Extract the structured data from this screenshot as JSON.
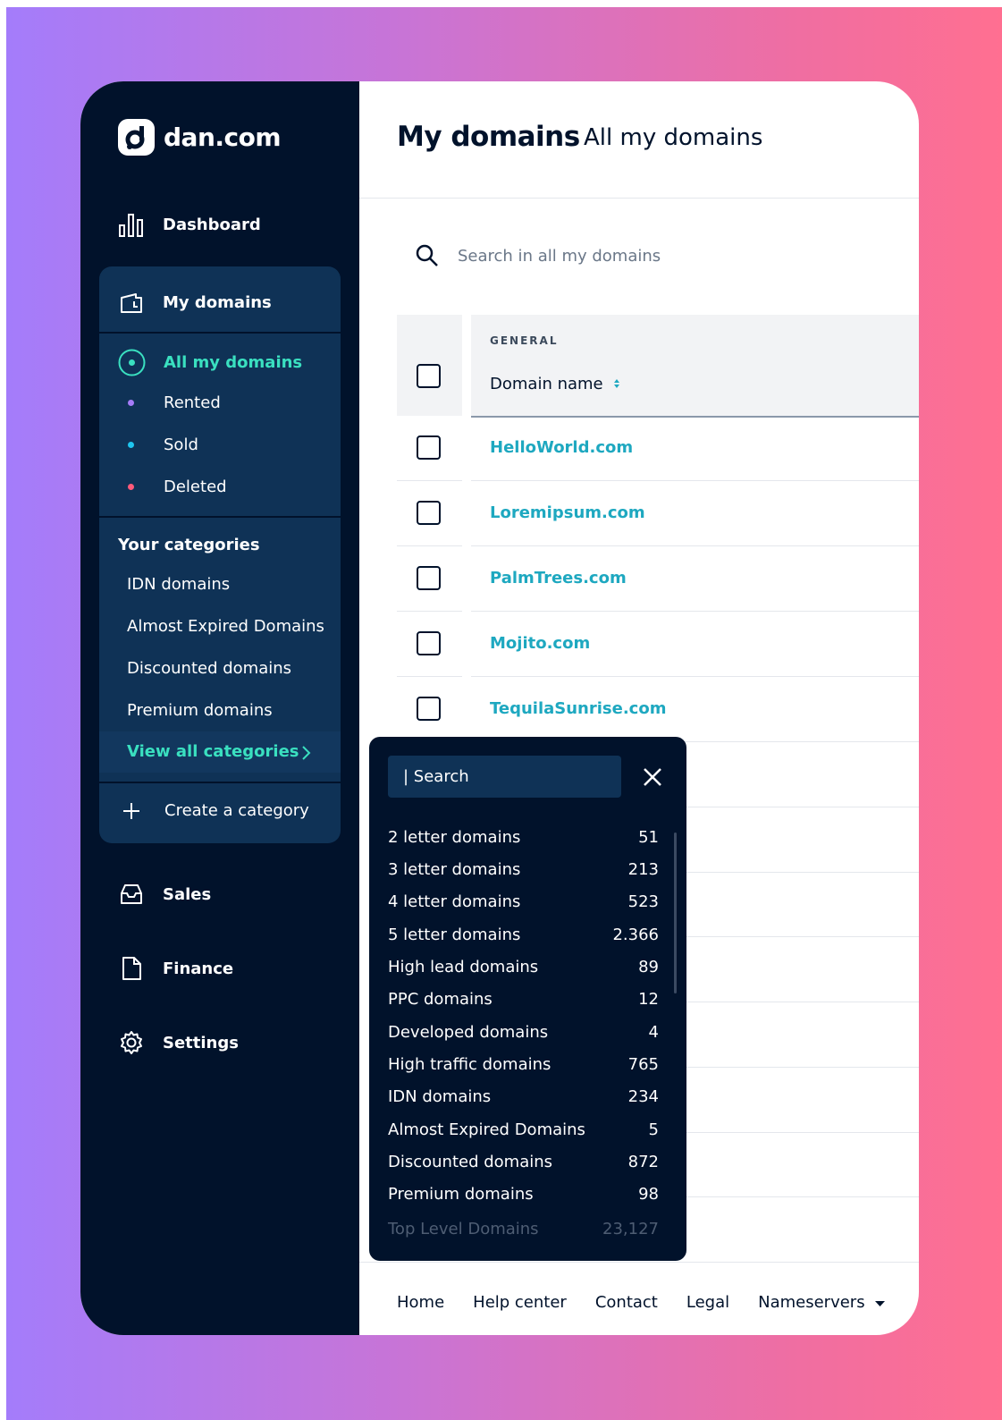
{
  "app": {
    "name": "dan.com"
  },
  "sidebar": {
    "dashboard": "Dashboard",
    "my_domains": "My domains",
    "filters": [
      {
        "label": "All my domains",
        "color": "#3ae0c0"
      },
      {
        "label": "Rented",
        "color": "#a57cf8"
      },
      {
        "label": "Sold",
        "color": "#1ec6f0"
      },
      {
        "label": "Deleted",
        "color": "#ff5a7a"
      }
    ],
    "categories_title": "Your categories",
    "categories": [
      "IDN domains",
      "Almost Expired Domains",
      "Discounted domains",
      "Premium domains"
    ],
    "view_all": "View all categories",
    "create": "Create a category",
    "sales": "Sales",
    "finance": "Finance",
    "settings": "Settings"
  },
  "main": {
    "title": "My domains",
    "subtitle": "All my domains",
    "search_placeholder": "Search in all my domains",
    "table": {
      "group_label": "GENERAL",
      "column": "Domain name",
      "rows": [
        "HelloWorld.com",
        "Loremipsum.com",
        "PalmTrees.com",
        "Mojito.com",
        "TequilaSunrise.com"
      ]
    }
  },
  "popup": {
    "search": "| Search",
    "items": [
      {
        "label": "2 letter domains",
        "count": "51"
      },
      {
        "label": "3 letter domains",
        "count": "213"
      },
      {
        "label": "4 letter domains",
        "count": "523"
      },
      {
        "label": "5 letter domains",
        "count": "2.366"
      },
      {
        "label": "High lead domains",
        "count": "89"
      },
      {
        "label": "PPC domains",
        "count": "12"
      },
      {
        "label": "Developed domains",
        "count": "4"
      },
      {
        "label": "High traffic domains",
        "count": "765"
      },
      {
        "label": "IDN domains",
        "count": "234"
      },
      {
        "label": "Almost Expired Domains",
        "count": "5"
      },
      {
        "label": "Discounted domains",
        "count": "872"
      },
      {
        "label": "Premium domains",
        "count": "98"
      },
      {
        "label": "Top Level Domains",
        "count": "23,127"
      }
    ]
  },
  "footer": {
    "links": [
      "Home",
      "Help center",
      "Contact",
      "Legal",
      "Nameservers"
    ]
  },
  "colors": {
    "sidebar": "#01122b",
    "panel": "#0f3256",
    "accent": "#3ae0c0",
    "link": "#1ea8c0"
  }
}
